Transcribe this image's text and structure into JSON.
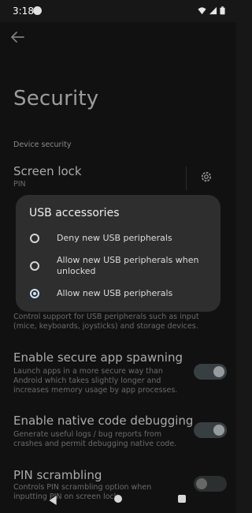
{
  "status_bar": {
    "time": "3:18",
    "icons": [
      "notification-icon",
      "wifi-icon",
      "signal-icon",
      "battery-icon"
    ]
  },
  "page": {
    "title": "Security"
  },
  "sections": {
    "device_security": {
      "label": "Device security",
      "screen_lock": {
        "title": "Screen lock",
        "summary": "PIN"
      },
      "usb_summary": "Control support for USB peripherals such as input (mice, keyboards, joysticks) and storage devices.",
      "secure_spawning": {
        "title": "Enable secure app spawning",
        "summary": "Launch apps in a more secure way than Android which takes slightly longer and increases memory usage by app processes."
      },
      "native_debugging": {
        "title": "Enable native code debugging",
        "summary": "Generate useful logs / bug reports from crashes and permit debugging native code."
      },
      "pin_scrambling": {
        "title": "PIN scrambling",
        "summary": "Controls PIN scrambling option when inputting PIN on screen lock"
      }
    }
  },
  "dialog": {
    "title": "USB accessories",
    "options": [
      {
        "label": "Deny new USB peripherals",
        "selected": false
      },
      {
        "label": "Allow new USB peripherals when unlocked",
        "selected": false
      },
      {
        "label": "Allow new USB peripherals",
        "selected": true
      }
    ]
  },
  "colors": {
    "background": "#171717",
    "dialog": "#2e2e2e",
    "accent": "#cfe6ff"
  }
}
